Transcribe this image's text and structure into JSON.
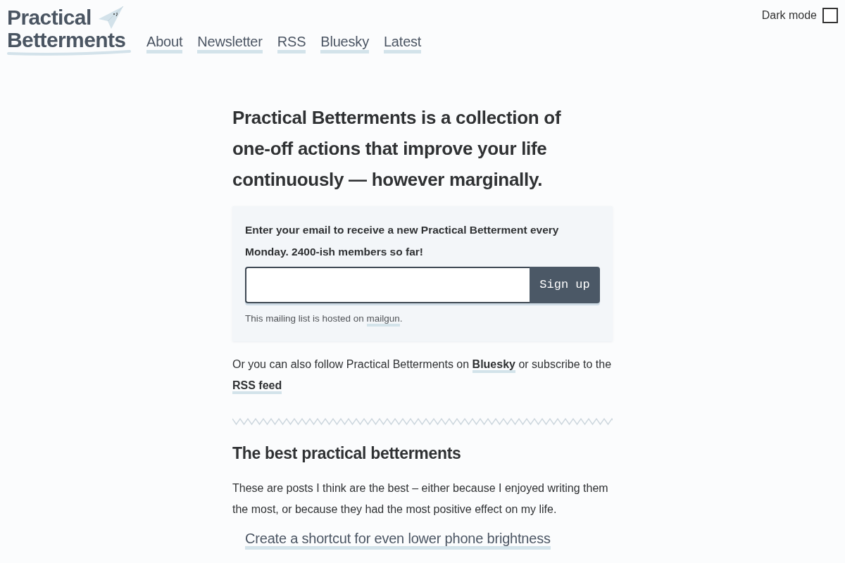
{
  "header": {
    "logo": {
      "lines": [
        "Practical",
        "Betterments"
      ]
    },
    "nav": [
      "About",
      "Newsletter",
      "RSS",
      "Bluesky",
      "Latest"
    ],
    "dark_mode": {
      "label": "Dark mode",
      "checked": false
    }
  },
  "headline": "Practical Betterments is a collection of one-off actions that improve your life continuously — however marginally.",
  "signup": {
    "prompt": "Enter your email to receive a new Practical Betterment every Monday. 2400-ish members so far!",
    "button": "Sign up",
    "note": [
      {
        "kind": "text",
        "text": "This mailing list is hosted on "
      },
      {
        "kind": "link",
        "text": "mailgun"
      },
      {
        "kind": "text",
        "text": "."
      }
    ]
  },
  "follow": [
    {
      "kind": "text",
      "text": "Or you can also follow Practical Betterments on "
    },
    {
      "kind": "strong_link",
      "text": "Bluesky"
    },
    {
      "kind": "text",
      "text": " or subscribe to the "
    },
    {
      "kind": "strong_link",
      "text": "RSS feed"
    }
  ],
  "best_section": {
    "title": "The best practical betterments",
    "intro": "These are posts I think are the best – either because I enjoyed writing them the most, or because they had the most positive effect on my life.",
    "posts": [
      {
        "title": "Create a shortcut for even lower phone brightness"
      }
    ]
  }
}
